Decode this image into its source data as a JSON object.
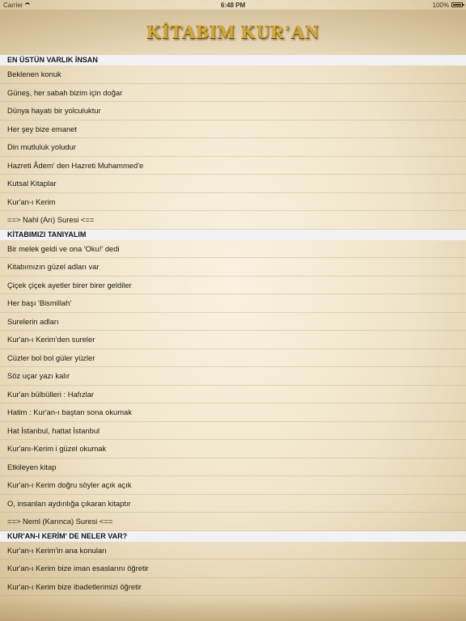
{
  "status_bar": {
    "carrier": "Carrier",
    "time": "6:48 PM",
    "battery": "100%"
  },
  "header": {
    "title": "KİTABIM KUR'AN"
  },
  "sections": [
    {
      "title": "EN ÜSTÜN VARLIK İNSAN",
      "items": [
        "Beklenen konuk",
        "Güneş, her sabah bizim için doğar",
        "Dünya hayatı bir yolculuktur",
        "Her şey bize emanet",
        "Din mutluluk yoludur",
        "Hazreti Âdem' den Hazreti Muhammed'e",
        "Kutsal Kitaplar",
        "Kur'an-ı Kerim",
        "==> Nahl (Arı) Suresi <=="
      ]
    },
    {
      "title": "KİTABIMIZI TANIYALIM",
      "items": [
        "Bir melek geldi ve ona 'Oku!' dedi",
        "Kitabımızın güzel adları var",
        "Çiçek çiçek ayetler birer birer geldiler",
        "Her başı 'Bismillah'",
        "Surelerin adları",
        "Kur'an-ı Kerim'den sureler",
        "Cüzler bol bol güler yüzler",
        "Söz uçar yazı kalır",
        "Kur'an bülbülleri : Hafızlar",
        "Hatim : Kur'an-ı baştan sona okumak",
        "Hat İstanbul, hattat İstanbul",
        "Kur'anı-Kerim i güzel okumak",
        "Etkileyen kitap",
        "Kur'an-ı Kerim doğru söyler açık açık",
        "O, insanları aydınlığa çıkaran kitaptır",
        "==> Neml (Karınca) Suresi <=="
      ]
    },
    {
      "title": "KUR'AN-I KERİM' DE NELER VAR?",
      "items": [
        "Kur'an-ı Kerim'in ana konuları",
        "Kur'an-ı Kerim bize iman esaslarını öğretir",
        "Kur'an-ı Kerim bize ibadetlerimizi öğretir"
      ]
    }
  ]
}
